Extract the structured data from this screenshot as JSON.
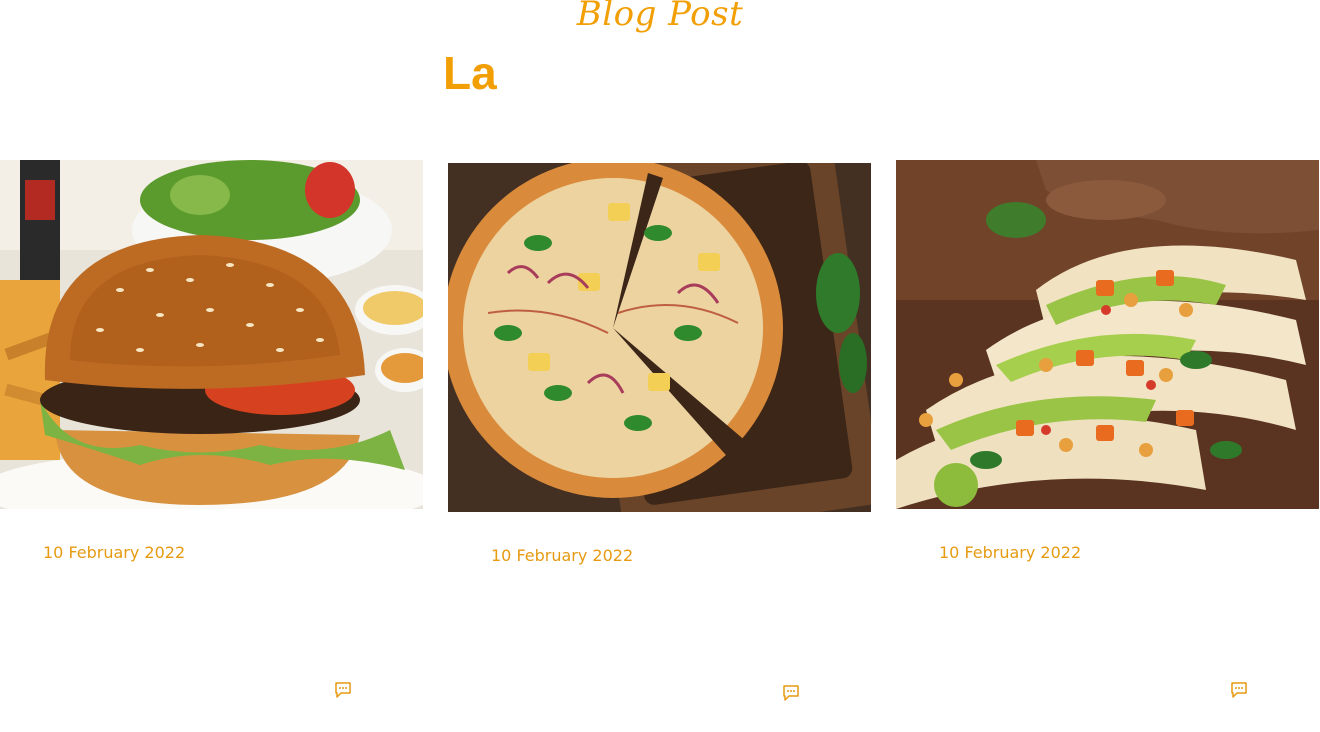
{
  "section": {
    "eyebrow": "Blog Post",
    "heading": "La"
  },
  "posts": [
    {
      "image": "burger-photo",
      "date": "10 February 2022",
      "comment_icon": "comment-icon"
    },
    {
      "image": "pizza-photo",
      "date": "10 February 2022",
      "comment_icon": "comment-icon"
    },
    {
      "image": "tacos-photo",
      "date": "10 February 2022",
      "comment_icon": "comment-icon"
    }
  ],
  "colors": {
    "accent": "#f29f05",
    "date_text": "#e69a12",
    "background": "#ffffff"
  }
}
